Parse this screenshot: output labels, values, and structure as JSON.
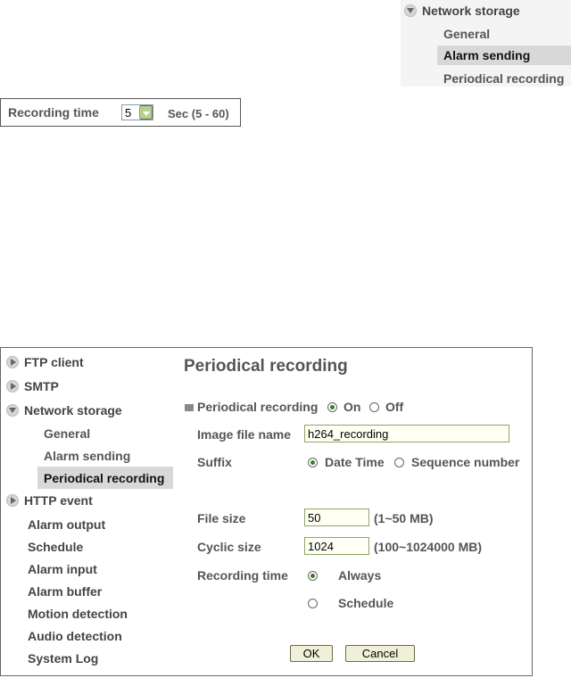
{
  "snippet_nav": {
    "network_storage": "Network storage",
    "general": "General",
    "alarm_sending": "Alarm sending",
    "periodical_recording": "Periodical recording"
  },
  "snippet_recording_time": {
    "label": "Recording time",
    "value": "5",
    "unit": "Sec (5 - 60)"
  },
  "sidebar": {
    "ftp_client": "FTP client",
    "smtp": "SMTP",
    "network_storage": "Network storage",
    "general": "General",
    "alarm_sending": "Alarm sending",
    "periodical_recording": "Periodical recording",
    "http_event": "HTTP event",
    "alarm_output": "Alarm output",
    "schedule": "Schedule",
    "alarm_input": "Alarm input",
    "alarm_buffer": "Alarm buffer",
    "motion_detection": "Motion detection",
    "audio_detection": "Audio detection",
    "system_log": "System Log"
  },
  "form": {
    "title": "Periodical recording",
    "periodical_recording_label": "Periodical recording",
    "on_label": "On",
    "off_label": "Off",
    "image_file_name_label": "Image file name",
    "image_file_name_value": "h264_recording",
    "suffix_label": "Suffix",
    "suffix_date_time": "Date Time",
    "suffix_sequence": "Sequence number",
    "file_size_label": "File size",
    "file_size_value": "50",
    "file_size_range": "(1~50 MB)",
    "cyclic_size_label": "Cyclic size",
    "cyclic_size_value": "1024",
    "cyclic_size_range": "(100~1024000 MB)",
    "recording_time_label": "Recording time",
    "always_label": "Always",
    "schedule_label": "Schedule",
    "ok_label": "OK",
    "cancel_label": "Cancel"
  }
}
